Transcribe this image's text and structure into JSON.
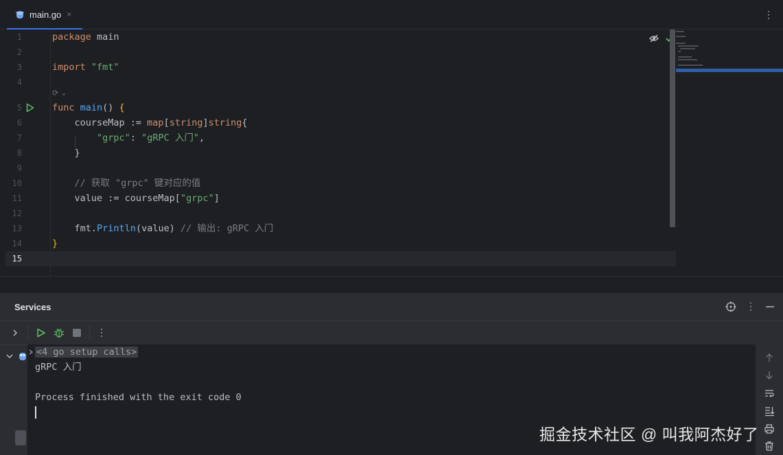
{
  "tab": {
    "filename": "main.go",
    "close": "×",
    "icon": "gopher-icon"
  },
  "editor": {
    "line_numbers": [
      "1",
      "2",
      "3",
      "4",
      "5",
      "6",
      "7",
      "8",
      "9",
      "10",
      "11",
      "12",
      "13",
      "14",
      "15"
    ],
    "inlay_hint": "⟳ ⌄",
    "code": {
      "l1_kw": "package",
      "l1_rest": " main",
      "l3_kw": "import",
      "l3_str": " \"fmt\"",
      "l5_kw": "func",
      "l5_fn": " main",
      "l5_rest": "() ",
      "l5_brace": "{",
      "l6_a": "    courseMap := ",
      "l6_kw1": "map",
      "l6_b": "[",
      "l6_kw2": "string",
      "l6_c": "]",
      "l6_kw3": "string",
      "l6_d": "{",
      "l7_a": "        ",
      "l7_s1": "\"grpc\"",
      "l7_b": ": ",
      "l7_s2": "\"gRPC 入门\"",
      "l7_c": ",",
      "l8": "    }",
      "l10": "    // 获取 \"grpc\" 键对应的值",
      "l11_a": "    value := courseMap[",
      "l11_s": "\"grpc\"",
      "l11_b": "]",
      "l13_a": "    fmt.",
      "l13_fn": "Println",
      "l13_b": "(value) ",
      "l13_c": "// 输出: gRPC 入门",
      "l14": "}"
    }
  },
  "services": {
    "title": "Services",
    "console": {
      "folded": "<4 go setup calls>",
      "output": "gRPC 入门",
      "process": "Process finished with the exit code 0"
    }
  },
  "watermark": "掘金技术社区 @ 叫我阿杰好了",
  "colors": {
    "keyword": "#cf8e6d",
    "function": "#56a8f5",
    "string": "#6aab73",
    "comment": "#7a7e85",
    "accent": "#3574f0",
    "run_green": "#5fb865"
  }
}
